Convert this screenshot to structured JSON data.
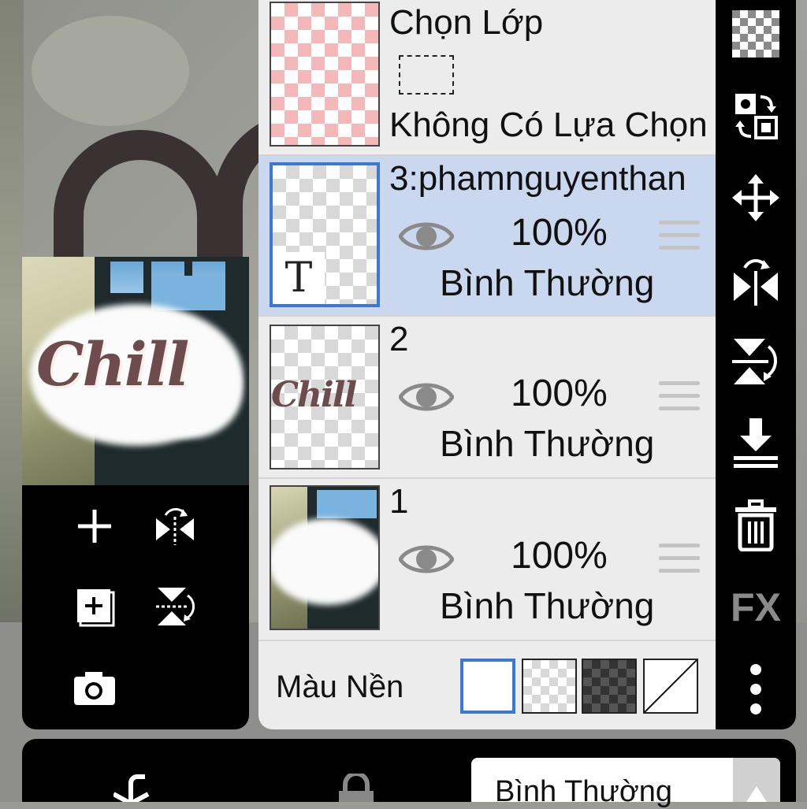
{
  "selection_row": {
    "title": "Chọn Lớp",
    "status": "Không Có Lựa Chọn"
  },
  "layers": [
    {
      "name": "3:phamnguyenthan",
      "opacity": "100%",
      "blend": "Bình Thường",
      "type": "text",
      "active": true,
      "badge": "T"
    },
    {
      "name": "2",
      "opacity": "100%",
      "blend": "Bình Thường",
      "type": "image",
      "active": false
    },
    {
      "name": "1",
      "opacity": "100%",
      "blend": "Bình Thường",
      "type": "image",
      "active": false
    }
  ],
  "background": {
    "label": "Màu Nền",
    "options": [
      "white",
      "transparent",
      "dark-checker",
      "none"
    ],
    "selected": "white"
  },
  "preview": {
    "text": "Chill"
  },
  "right_toolbar": {
    "items": [
      "transparency-icon",
      "swap-icon",
      "move-icon",
      "flip-horizontal-icon",
      "flip-vertical-icon",
      "merge-down-icon",
      "delete-icon",
      "fx-button",
      "more-icon"
    ],
    "fx_label": "FX"
  },
  "left_toolbar": {
    "items": [
      "add-layer-icon",
      "flip-layer-horizontal-icon",
      "add-copy-layer-icon",
      "flip-layer-vertical-icon",
      "camera-icon"
    ]
  },
  "bottom_bar": {
    "blend_mode_value": "Bình Thường"
  },
  "colors": {
    "accent": "#3a78d4",
    "active_row": "#c9d8ee",
    "panel": "#ececec",
    "toolbar": "#000000"
  }
}
